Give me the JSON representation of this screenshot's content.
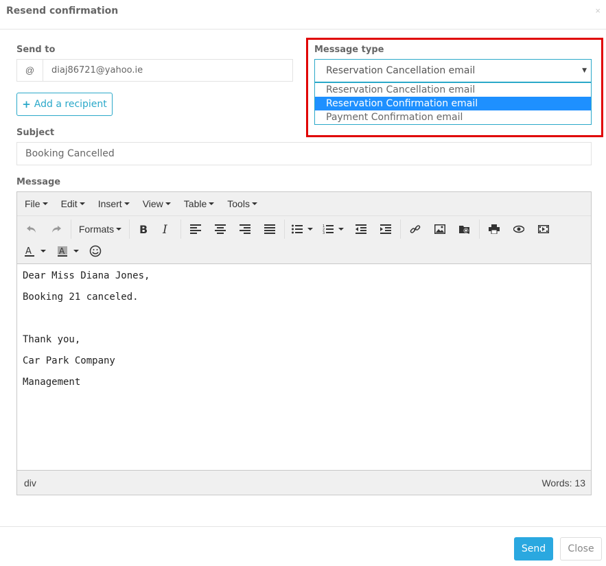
{
  "modal": {
    "title": "Resend confirmation",
    "close_glyph": "×"
  },
  "send_to": {
    "label": "Send to",
    "addon": "@",
    "value": "diaj86721@yahoo.ie"
  },
  "add_recipient": {
    "plus": "+",
    "label": "Add a recipient"
  },
  "message_type": {
    "label": "Message type",
    "selected": "Reservation Cancellation email",
    "options": [
      "Reservation Cancellation email",
      "Reservation Confirmation email",
      "Payment Confirmation email"
    ],
    "highlighted_index": 1
  },
  "subject": {
    "label": "Subject",
    "value": "Booking Cancelled"
  },
  "message": {
    "label": "Message",
    "menu": [
      "File",
      "Edit",
      "Insert",
      "View",
      "Table",
      "Tools"
    ],
    "formats_label": "Formats",
    "body": [
      "Dear Miss Diana Jones,",
      "Booking 21 canceled.",
      "",
      "Thank you,",
      "Car Park Company",
      "Management"
    ],
    "status_path": "div",
    "word_count": "Words: 13"
  },
  "footer": {
    "send": "Send",
    "close": "Close"
  },
  "colors": {
    "accent": "#2aa8c9",
    "highlight_border": "#e00000",
    "selected_option": "#1e90ff",
    "send_button": "#2aa8e0"
  }
}
